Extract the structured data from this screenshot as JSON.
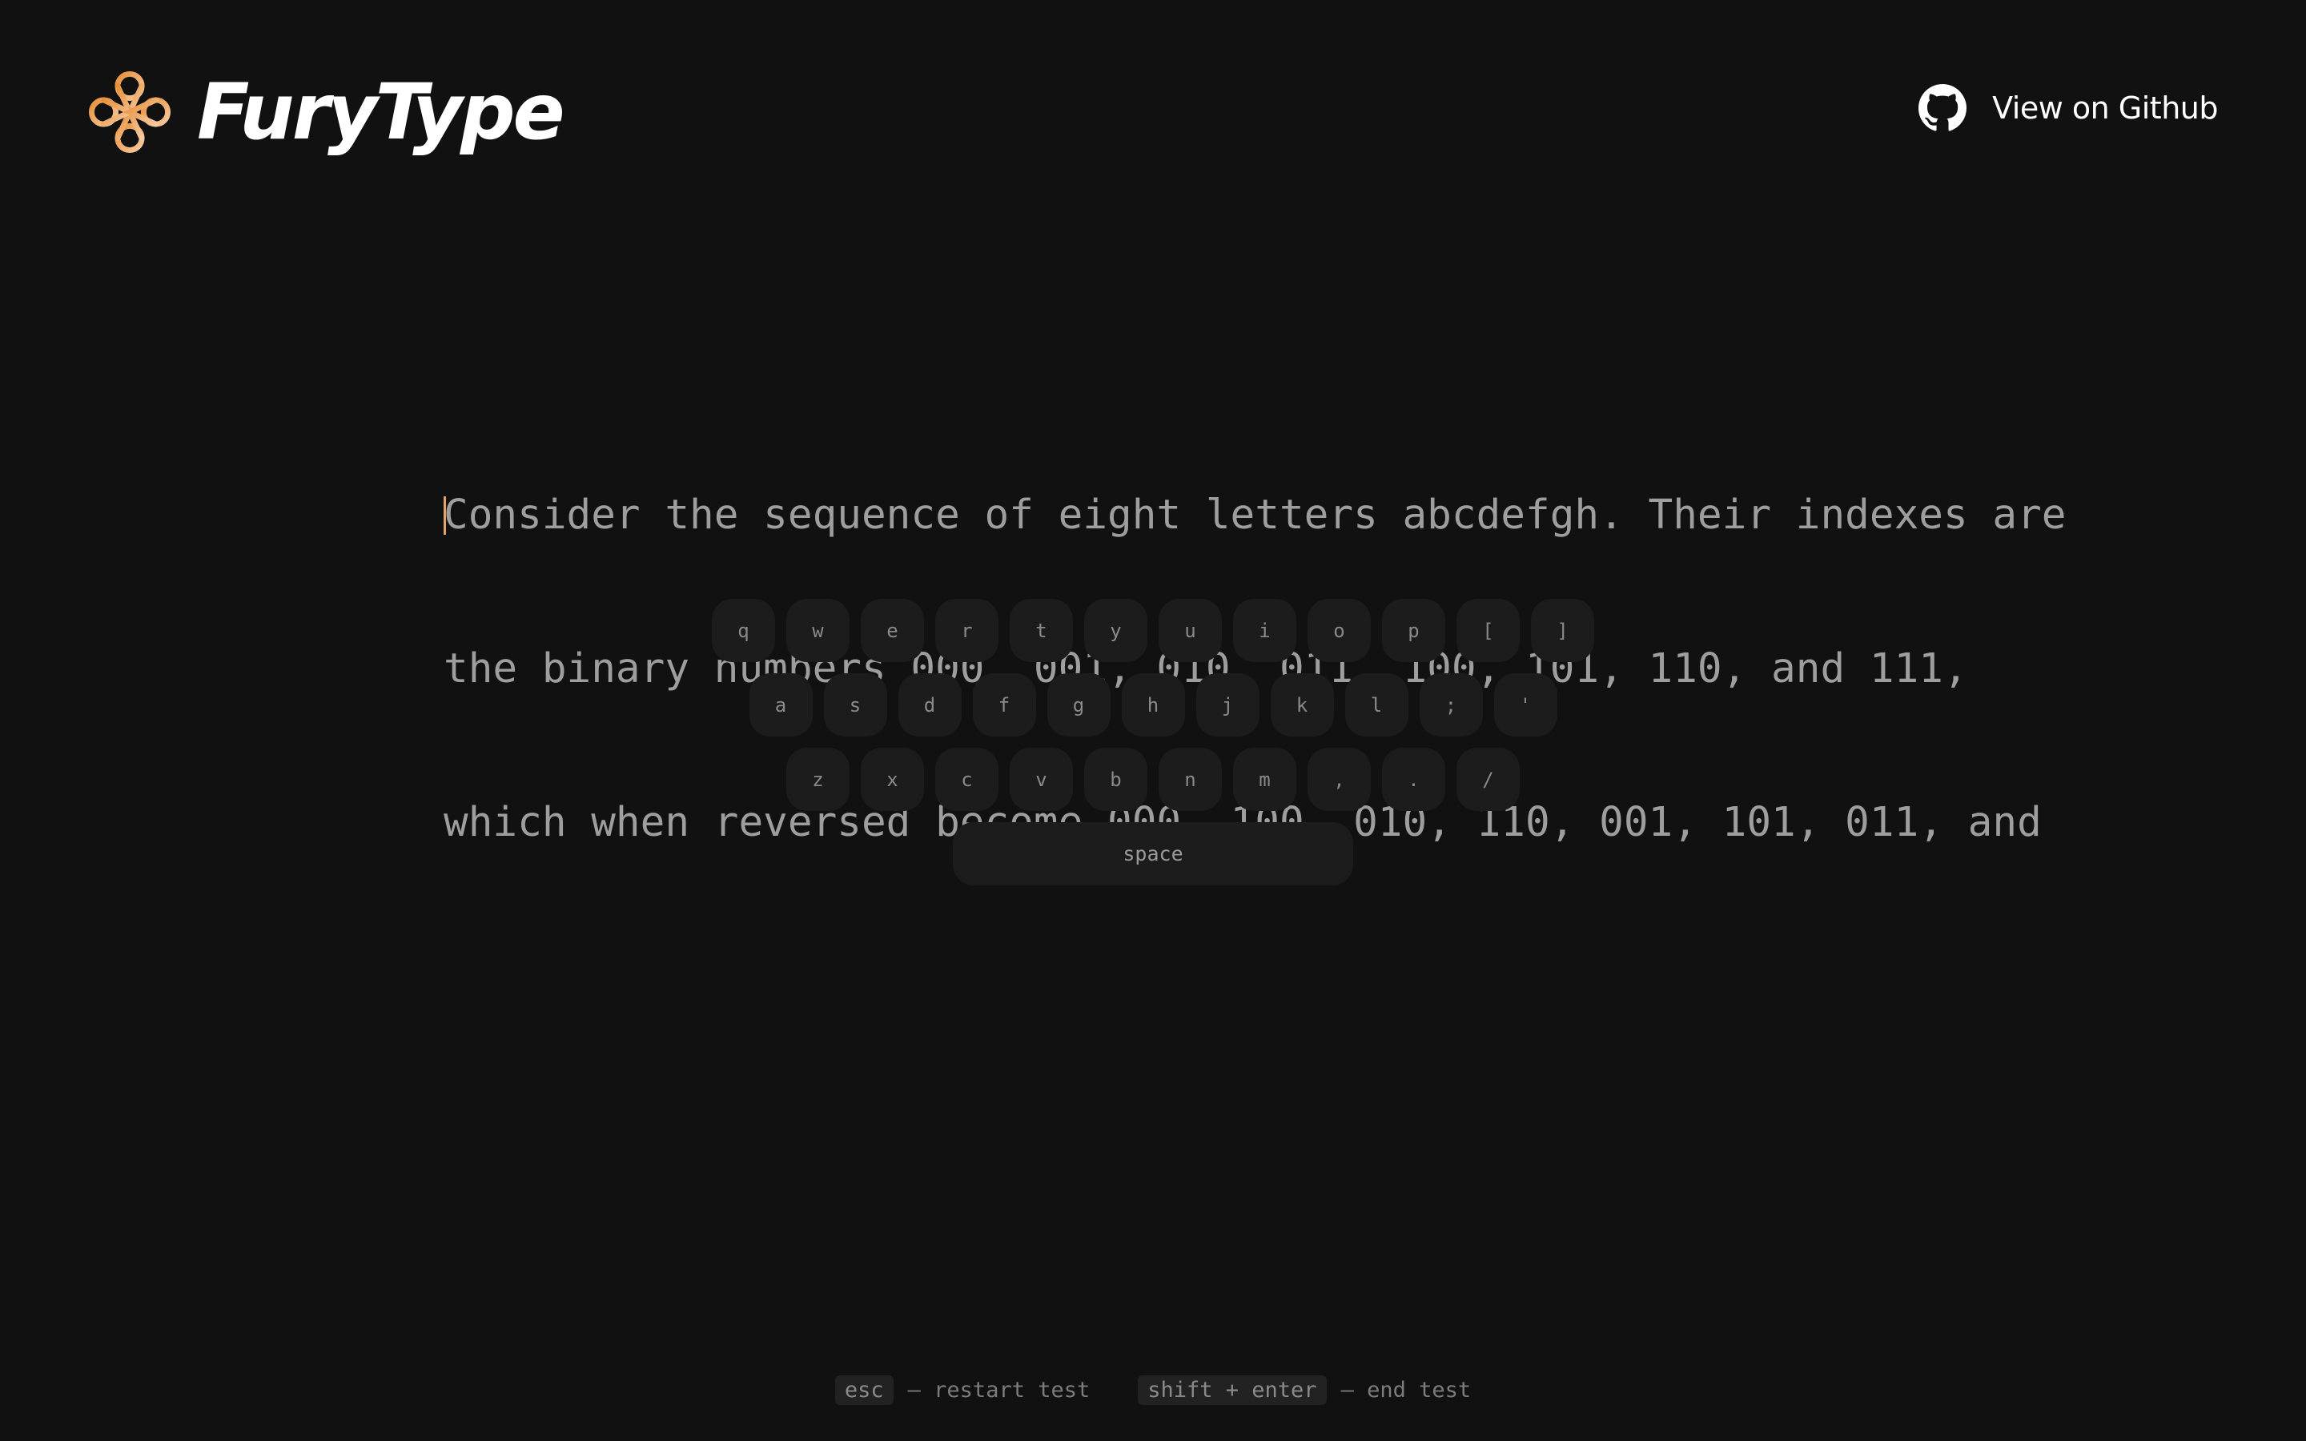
{
  "header": {
    "brand_name": "FuryType",
    "logo_icon": "celtic-knot-logo",
    "github_label": "View on Github",
    "github_icon": "github-icon"
  },
  "typing": {
    "lines": [
      "Consider the sequence of eight letters abcdefgh. Their indexes are",
      "the binary numbers 000, 001, 010, 011, 100, 101, 110, and 111,",
      "which when reversed become 000, 100, 010, 110, 001, 101, 011, and"
    ],
    "caret_color": "#e8a36b"
  },
  "keyboard": {
    "rows": [
      [
        "q",
        "w",
        "e",
        "r",
        "t",
        "y",
        "u",
        "i",
        "o",
        "p",
        "[",
        "]"
      ],
      [
        "a",
        "s",
        "d",
        "f",
        "g",
        "h",
        "j",
        "k",
        "l",
        ";",
        "'"
      ],
      [
        "z",
        "x",
        "c",
        "v",
        "b",
        "n",
        "m",
        ",",
        ".",
        "/"
      ]
    ],
    "space_label": "space"
  },
  "hints": {
    "restart_key": "esc",
    "restart_text": "— restart test",
    "end_key": "shift + enter",
    "end_text": "— end test"
  },
  "colors": {
    "background": "#111111",
    "accent_orange": "#e8913a",
    "accent_light": "#f6c9a0",
    "text_muted": "#9e9e9e",
    "key_bg": "#1c1c1c"
  }
}
